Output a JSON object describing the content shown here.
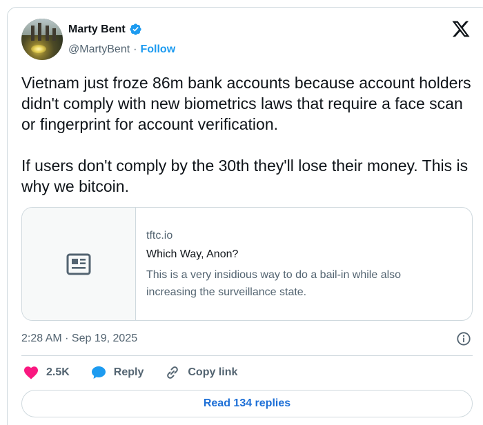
{
  "author": {
    "name": "Marty Bent",
    "handle": "@MartyBent",
    "separator": "·",
    "follow_label": "Follow"
  },
  "tweet": {
    "paragraphs": [
      "Vietnam just froze 86m bank accounts because account holders didn't comply with new biometrics laws that require a face scan or fingerprint for account verification.",
      "If users don't comply by the 30th they'll lose their money. This is why we bitcoin."
    ]
  },
  "link_card": {
    "domain": "tftc.io",
    "title": "Which Way, Anon?",
    "description": "This is a very insidious way to do a bail-in while also increasing the surveillance state."
  },
  "meta": {
    "timestamp": "2:28 AM · Sep 19, 2025"
  },
  "actions": {
    "like_count": "2.5K",
    "reply_label": "Reply",
    "copy_link_label": "Copy link"
  },
  "replies_button": {
    "label": "Read 134 replies"
  },
  "colors": {
    "accent": "#1d9bf0",
    "like": "#f91880",
    "text": "#0f1419",
    "muted": "#536471",
    "border": "#cfd9de"
  },
  "icons": {
    "verified": "verified-badge-icon",
    "x_logo": "x-logo-icon",
    "article": "article-icon",
    "info": "info-icon",
    "like": "heart-icon",
    "reply": "speech-bubble-icon",
    "copy_link": "link-icon"
  }
}
